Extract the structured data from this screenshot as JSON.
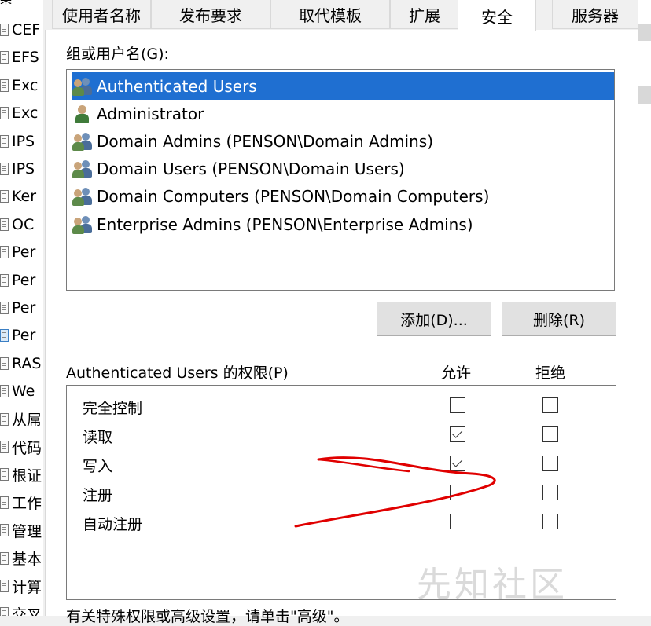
{
  "left_list": {
    "header_fragment": "棸",
    "items": [
      {
        "label": "CEF"
      },
      {
        "label": "EFS"
      },
      {
        "label": "Exc"
      },
      {
        "label": "Exc"
      },
      {
        "label": "IPS"
      },
      {
        "label": "IPS"
      },
      {
        "label": "Ker"
      },
      {
        "label": "OC"
      },
      {
        "label": "Per"
      },
      {
        "label": "Per"
      },
      {
        "label": "Per"
      },
      {
        "label": "Per"
      },
      {
        "label": "RAS"
      },
      {
        "label": "We"
      },
      {
        "label": "从屌"
      },
      {
        "label": "代码"
      },
      {
        "label": "根证"
      },
      {
        "label": "工作"
      },
      {
        "label": "管理"
      },
      {
        "label": "基本"
      },
      {
        "label": "计算"
      },
      {
        "label": "交叉"
      }
    ],
    "selected_index": 11
  },
  "tabs": [
    {
      "label": "使用者名称"
    },
    {
      "label": "发布要求"
    },
    {
      "label": "取代模板"
    },
    {
      "label": "扩展"
    },
    {
      "label": "安全"
    },
    {
      "label": "服务器"
    }
  ],
  "active_tab": "安全",
  "groups_label": "组或用户名(G):",
  "users": [
    {
      "name": "Authenticated Users",
      "icon": "users-group-icon",
      "selected": true
    },
    {
      "name": "Administrator",
      "icon": "user-icon",
      "selected": false
    },
    {
      "name": "Domain Admins (PENSON\\Domain Admins)",
      "icon": "users-group-icon",
      "selected": false
    },
    {
      "name": "Domain Users (PENSON\\Domain Users)",
      "icon": "users-group-icon",
      "selected": false
    },
    {
      "name": "Domain Computers (PENSON\\Domain Computers)",
      "icon": "users-group-icon",
      "selected": false
    },
    {
      "name": "Enterprise Admins (PENSON\\Enterprise Admins)",
      "icon": "users-group-icon",
      "selected": false
    }
  ],
  "buttons": {
    "add": "添加(D)...",
    "remove": "删除(R)"
  },
  "permissions_label": "Authenticated Users 的权限(P)",
  "allow_header": "允许",
  "deny_header": "拒绝",
  "permissions": [
    {
      "name": "完全控制",
      "allow": false,
      "deny": false
    },
    {
      "name": "读取",
      "allow": true,
      "deny": false
    },
    {
      "name": "写入",
      "allow": true,
      "deny": false
    },
    {
      "name": "注册",
      "allow": false,
      "deny": false
    },
    {
      "name": "自动注册",
      "allow": false,
      "deny": false
    }
  ],
  "bottom_text_fragment": "有关特殊权限或高级设置，请单击\"高级\"。",
  "watermark": "先知社区",
  "colors": {
    "selection": "#1f6fd1",
    "annotation": "#e00000"
  }
}
